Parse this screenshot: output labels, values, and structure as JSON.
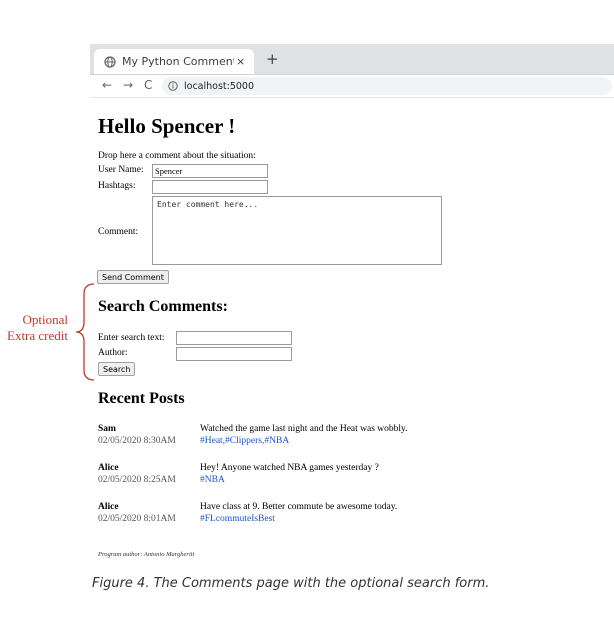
{
  "browser": {
    "tab_title": "My Python Comment E",
    "tab_close": "×",
    "new_tab": "+",
    "nav_back": "←",
    "nav_forward": "→",
    "nav_reload": "C",
    "url": "localhost:5000"
  },
  "page": {
    "heading": "Hello Spencer !",
    "prompt": "Drop here a comment about the situation:",
    "form": {
      "username_label": "User Name:",
      "username_value": "Spencer",
      "hashtags_label": "Hashtags:",
      "hashtags_value": "",
      "comment_label": "Comment:",
      "comment_placeholder": "Enter comment here...",
      "send_button": "Send Comment"
    },
    "search": {
      "heading": "Search Comments:",
      "text_label": "Enter search text:",
      "text_value": "",
      "author_label": "Author:",
      "author_value": "",
      "button": "Search"
    },
    "recent": {
      "heading": "Recent Posts",
      "posts": [
        {
          "author": "Sam",
          "time": "02/05/2020 8:30AM",
          "text": "Watched the game last night and the Heat was wobbly.",
          "tags": "#Heat,#Clippers,#NBA"
        },
        {
          "author": "Alice",
          "time": "02/05/2020 8:25AM",
          "text": "Hey! Anyone watched NBA games yesterday ?",
          "tags": "#NBA"
        },
        {
          "author": "Alice",
          "time": "02/05/2020 8:01AM",
          "text": "Have class at 9. Better commute be awesome today.",
          "tags": "#FLcommuteIsBest"
        }
      ]
    },
    "footer": "Program author: Antonio Margheriti"
  },
  "annotation": {
    "line1": "Optional",
    "line2": "Extra credit",
    "color": "#c0392b"
  },
  "caption": "Figure 4. The Comments page with the optional search form."
}
